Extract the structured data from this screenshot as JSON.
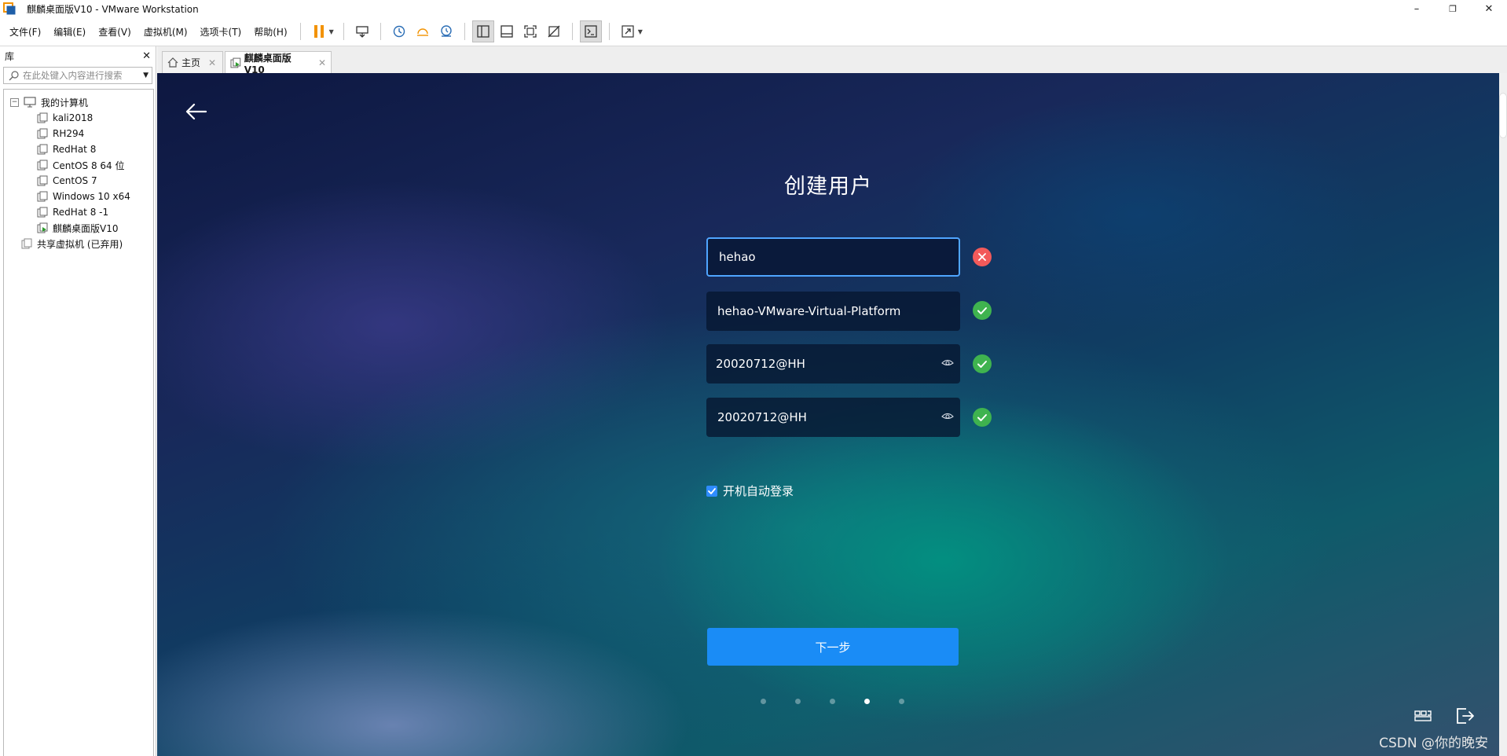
{
  "window": {
    "title": "麒麟桌面版V10 - VMware Workstation",
    "minimize": "–",
    "maximize": "❐",
    "close": "✕"
  },
  "menu": [
    "文件(F)",
    "编辑(E)",
    "查看(V)",
    "虚拟机(M)",
    "选项卡(T)",
    "帮助(H)"
  ],
  "library": {
    "title": "库",
    "close": "✕",
    "search_placeholder": "在此处键入内容进行搜索",
    "root": "我的计算机",
    "vms": [
      "kali2018",
      "RH294",
      "RedHat 8",
      "CentOS 8 64 位",
      "CentOS 7",
      "Windows 10 x64",
      "RedHat 8 -1",
      "麒麟桌面版V10"
    ],
    "shared": "共享虚拟机 (已弃用)"
  },
  "tabs": [
    {
      "label": "主页",
      "close": "✕"
    },
    {
      "label": "麒麟桌面版V10",
      "close": "✕"
    }
  ],
  "installer": {
    "title": "创建用户",
    "username": "hehao",
    "hostname": "hehao-VMware-Virtual-Platform",
    "password": "20020712@HH",
    "confirm_password": "20020712@HH",
    "autologin_label": "开机自动登录",
    "autologin_checked": true,
    "next_button": "下一步",
    "step_current": 4,
    "step_total": 5
  },
  "colors": {
    "accent": "#1a8cf6",
    "ok": "#3fb34f",
    "error": "#f25a5a"
  },
  "watermark": "CSDN @你的晚安"
}
